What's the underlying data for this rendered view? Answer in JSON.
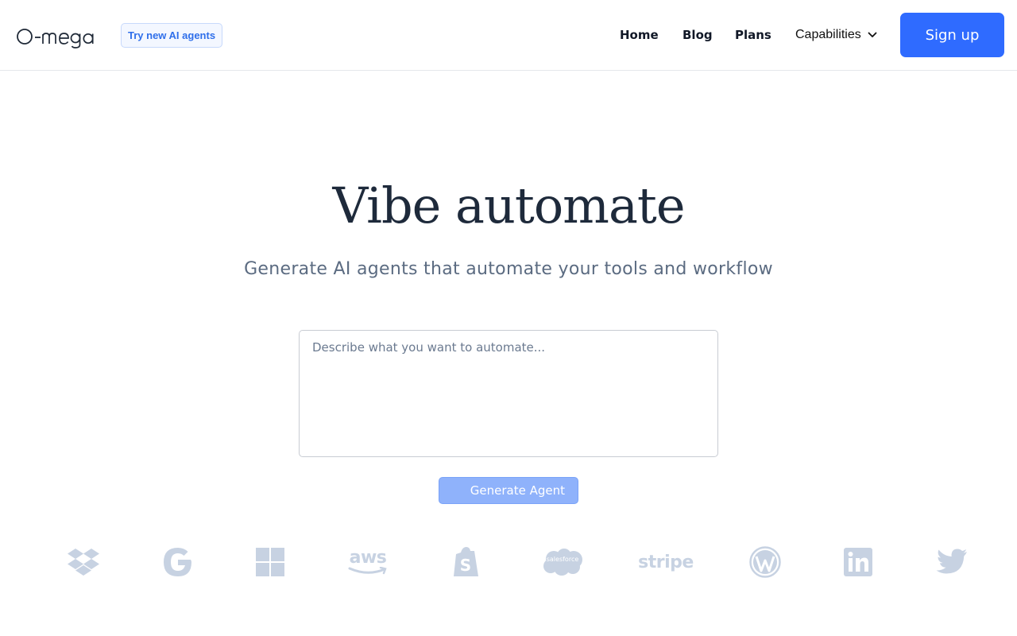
{
  "header": {
    "logo_text": "O-mega",
    "badge": "Try new AI agents",
    "nav": {
      "home": "Home",
      "blog": "Blog",
      "plans": "Plans",
      "capabilities": "Capabilities"
    },
    "signup": "Sign up"
  },
  "hero": {
    "title": "Vibe automate",
    "subtitle": "Generate AI agents that automate your tools and workflow"
  },
  "prompt": {
    "placeholder": "Describe what you want to automate...",
    "value": ""
  },
  "generate_button": "Generate Agent",
  "integrations": {
    "color": "#c7d2e2",
    "items": [
      {
        "name": "dropbox-icon"
      },
      {
        "name": "google-icon"
      },
      {
        "name": "windows-icon"
      },
      {
        "name": "aws-icon",
        "text": "aws"
      },
      {
        "name": "shopify-icon"
      },
      {
        "name": "salesforce-icon",
        "text": "salesforce"
      },
      {
        "name": "stripe-icon",
        "text": "stripe"
      },
      {
        "name": "wordpress-icon"
      },
      {
        "name": "linkedin-icon",
        "text": "in"
      },
      {
        "name": "twitter-icon"
      }
    ]
  },
  "colors": {
    "accent": "#2f6bff",
    "badge_text": "#2f6fea",
    "title": "#1e2a3b",
    "subtitle": "#5b6b81",
    "logo_gray": "#c7d2e2"
  }
}
